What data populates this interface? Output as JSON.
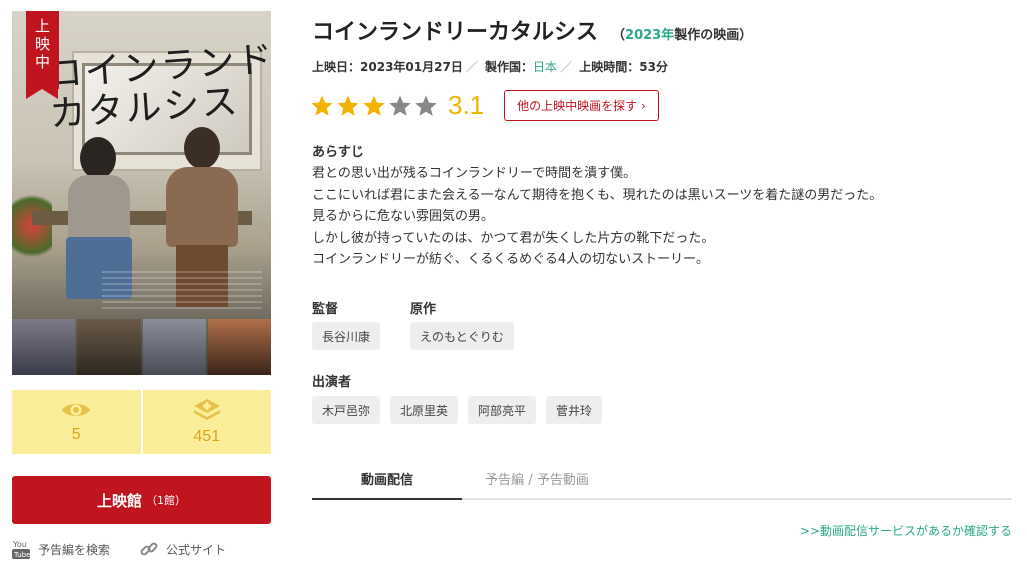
{
  "poster": {
    "ribbon": [
      "上",
      "映",
      "中"
    ],
    "title_art": "コインランドリー\nカタルシス"
  },
  "stats": {
    "views": "5",
    "adds": "451"
  },
  "theater_button": {
    "label": "上映館",
    "count": "（1館）"
  },
  "links": {
    "trailer_search": "予告編を検索",
    "official_site": "公式サイト"
  },
  "movie": {
    "title": "コインランドリーカタルシス",
    "year_paren_open": "（",
    "year": "2023年",
    "year_suffix": "製作の映画）",
    "release_label": "上映日：",
    "release_date": "2023年01月27日",
    "country_label": "製作国：",
    "country": "日本",
    "runtime_label": "上映時間：",
    "runtime": "53分",
    "separator": "／",
    "rating": "3.1",
    "rating_stars": 3,
    "other_movies_button": "他の上映中映画を探す ›"
  },
  "synopsis": {
    "heading": "あらすじ",
    "lines": [
      "君との思い出が残るコインランドリーで時間を潰す僕。",
      "ここにいれば君にまた会える一なんて期待を抱くも、現れたのは黒いスーツを着た謎の男だった。",
      "見るからに危ない雰囲気の男。",
      "しかし彼が持っていたのは、かつて君が失くした片方の靴下だった。",
      "コインランドリーが紡ぐ、くるくるめぐる4人の切ないストーリー。"
    ]
  },
  "credits": {
    "director_heading": "監督",
    "director": "長谷川康",
    "original_heading": "原作",
    "original": "えのもとぐりむ",
    "cast_heading": "出演者",
    "cast": [
      "木戸邑弥",
      "北原里英",
      "阿部亮平",
      "菅井玲"
    ]
  },
  "tabs": [
    "動画配信",
    "予告編 / 予告動画"
  ],
  "service_link": ">>動画配信サービスがあるか確認する",
  "colors": {
    "brand_red": "#c0141f",
    "teal": "#2aa88a",
    "star": "#f0b400",
    "stat_bg": "#fbee9a"
  }
}
